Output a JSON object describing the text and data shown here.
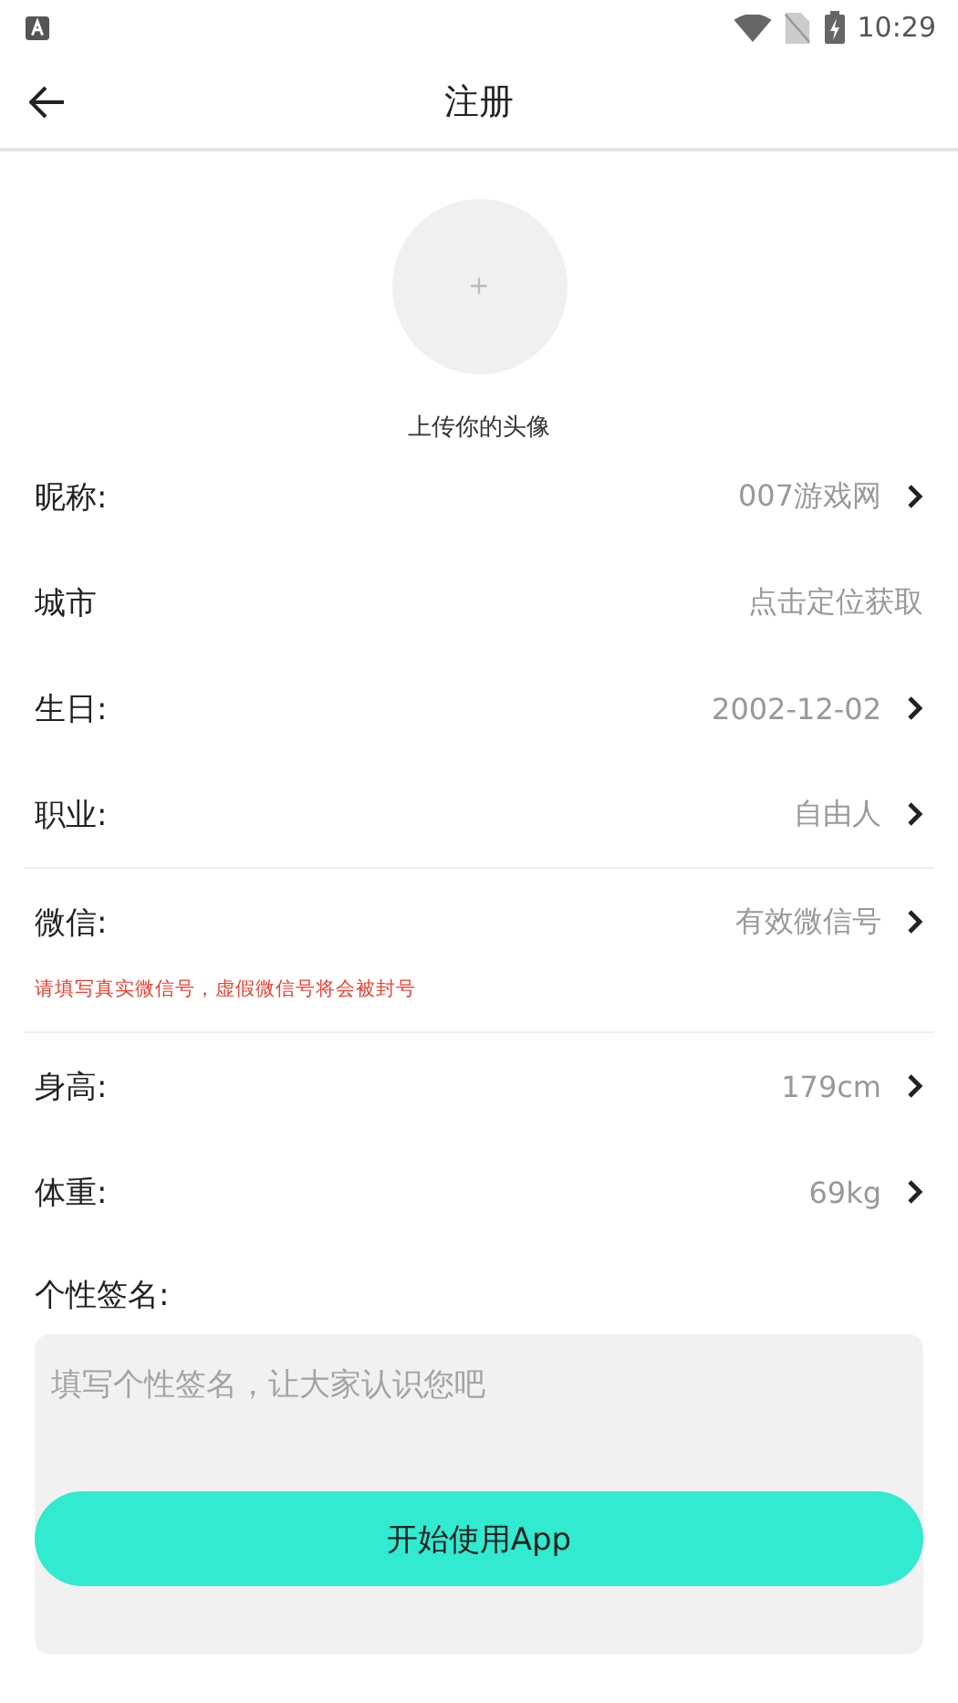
{
  "status_bar": {
    "time": "10:29"
  },
  "header": {
    "title": "注册"
  },
  "avatar": {
    "plus": "+",
    "caption": "上传你的头像"
  },
  "sections": [
    {
      "rows": [
        {
          "label": "昵称:",
          "value": "007游戏网",
          "arrow": true
        },
        {
          "label": "城市",
          "value": "点击定位获取",
          "arrow": false
        },
        {
          "label": "生日:",
          "value": "2002-12-02",
          "arrow": true
        },
        {
          "label": "职业:",
          "value": "自由人",
          "arrow": true
        }
      ]
    },
    {
      "rows": [
        {
          "label": "微信:",
          "value": "有效微信号",
          "arrow": true
        }
      ],
      "note": "请填写真实微信号，虚假微信号将会被封号"
    },
    {
      "rows": [
        {
          "label": "身高:",
          "value": "179cm",
          "arrow": true
        },
        {
          "label": "体重:",
          "value": "69kg",
          "arrow": true
        }
      ]
    }
  ],
  "signature": {
    "label": "个性签名:",
    "placeholder": "填写个性签名，让大家认识您吧"
  },
  "submit": "开始使用App"
}
